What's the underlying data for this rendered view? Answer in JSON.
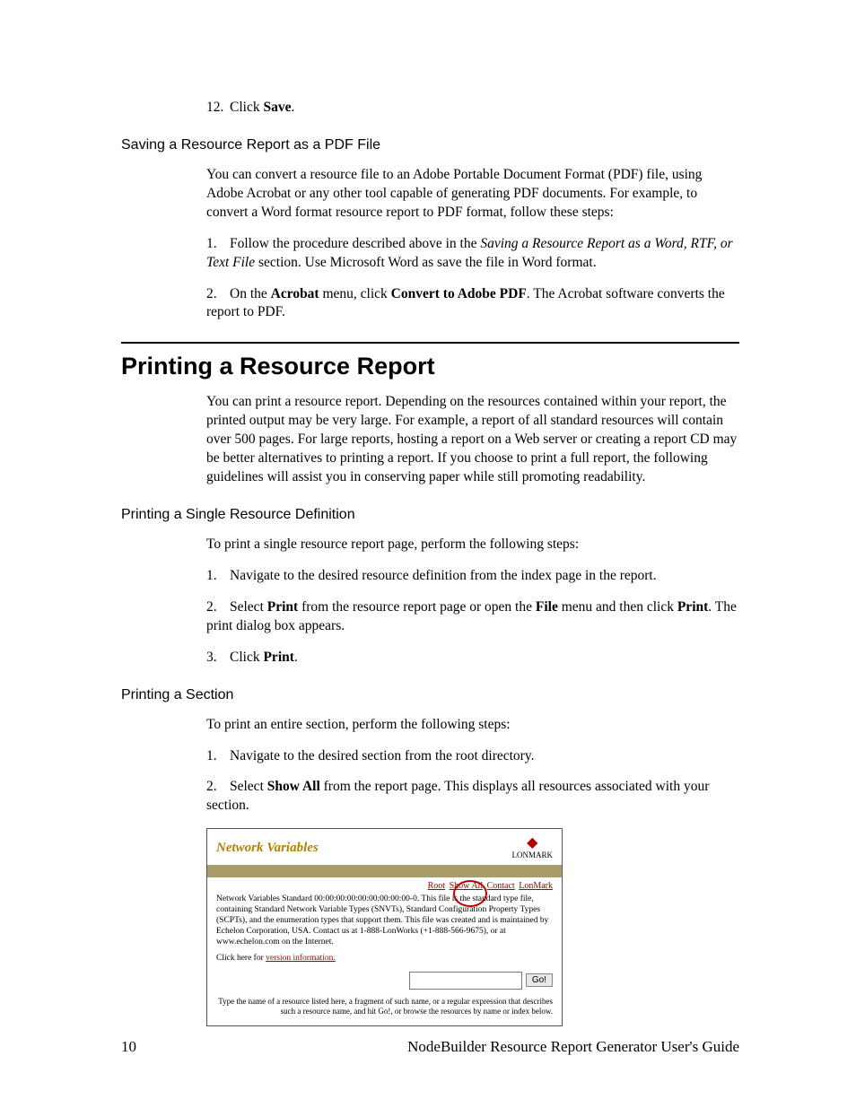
{
  "step12": {
    "num": "12.",
    "pre": "Click ",
    "b": "Save",
    "post": "."
  },
  "h3_savePdf": "Saving a Resource Report as a PDF File",
  "p_savePdf": "You can convert a resource file to an Adobe Portable Document Format (PDF) file, using Adobe Acrobat or any other tool capable of generating PDF documents. For example, to convert a Word format resource report to PDF format, follow these steps:",
  "pdfSteps": [
    {
      "num": "1.",
      "pre": "Follow the procedure described above in the ",
      "i": "Saving a Resource Report as a Word, RTF, or Text File",
      "post": " section. Use Microsoft Word as save the file in Word format."
    },
    {
      "num": "2.",
      "pre": "On the ",
      "b1": "Acrobat",
      "mid1": " menu, click ",
      "b2": "Convert to Adobe PDF",
      "post": ". The Acrobat software converts the report to PDF."
    }
  ],
  "h1_print": "Printing a Resource Report",
  "p_printIntro": "You can print a resource report. Depending on the resources contained within your report, the printed output may be very large. For example, a report of all standard resources will contain over 500 pages. For large reports, hosting a report on a Web server or creating a report CD may be better alternatives to printing a report. If you choose to print a full report, the following guidelines will assist you in conserving paper while still promoting readability.",
  "h3_single": "Printing a Single Resource Definition",
  "p_single": "To print a single resource report page, perform the following steps:",
  "singleSteps": [
    {
      "num": "1.",
      "text": "Navigate to the desired resource definition from the index page in the report."
    },
    {
      "num": "2.",
      "pre": "Select ",
      "b1": "Print",
      "mid1": " from the resource report page or open the ",
      "b2": "File",
      "mid2": " menu and then click ",
      "b3": "Print",
      "post": ". The print dialog box appears."
    },
    {
      "num": "3.",
      "pre": "Click ",
      "b1": "Print",
      "post": "."
    }
  ],
  "h3_section": "Printing a Section",
  "p_section": "To print an entire section, perform the following steps:",
  "sectionSteps": [
    {
      "num": "1.",
      "text": "Navigate to the desired section from the root directory."
    },
    {
      "num": "2.",
      "pre": "Select ",
      "b1": "Show All",
      "post": " from the report page. This displays all resources associated with your section."
    }
  ],
  "figure": {
    "title": "Network Variables",
    "logoText": "LONMARK",
    "links": {
      "root": "Root",
      "showAll": "Show All",
      "contact": "Contact",
      "lonmark": "LonMark"
    },
    "desc": "Network Variables Standard 00:00:00:00:00:00:00:00:00-0. This file is the standard type file, containing Standard Network Variable Types (SNVTs), Standard Configuration Property Types (SCPTs), and the enumeration types that support them.  This file was created and is maintained by Echelon Corporation, USA. Contact us at 1-888-LonWorks (+1-888-566-9675), or at www.echelon.com on the Internet.",
    "versionPre": "Click here for ",
    "versionLink": "version information.",
    "goLabel": "Go!",
    "hint": "Type the name of a resource listed here, a fragment of such name, or a regular expression that describes such a resource name, and hit Go!, or browse the resources by name or index below."
  },
  "footer": {
    "pageNum": "10",
    "title": "NodeBuilder Resource Report Generator User's Guide"
  }
}
